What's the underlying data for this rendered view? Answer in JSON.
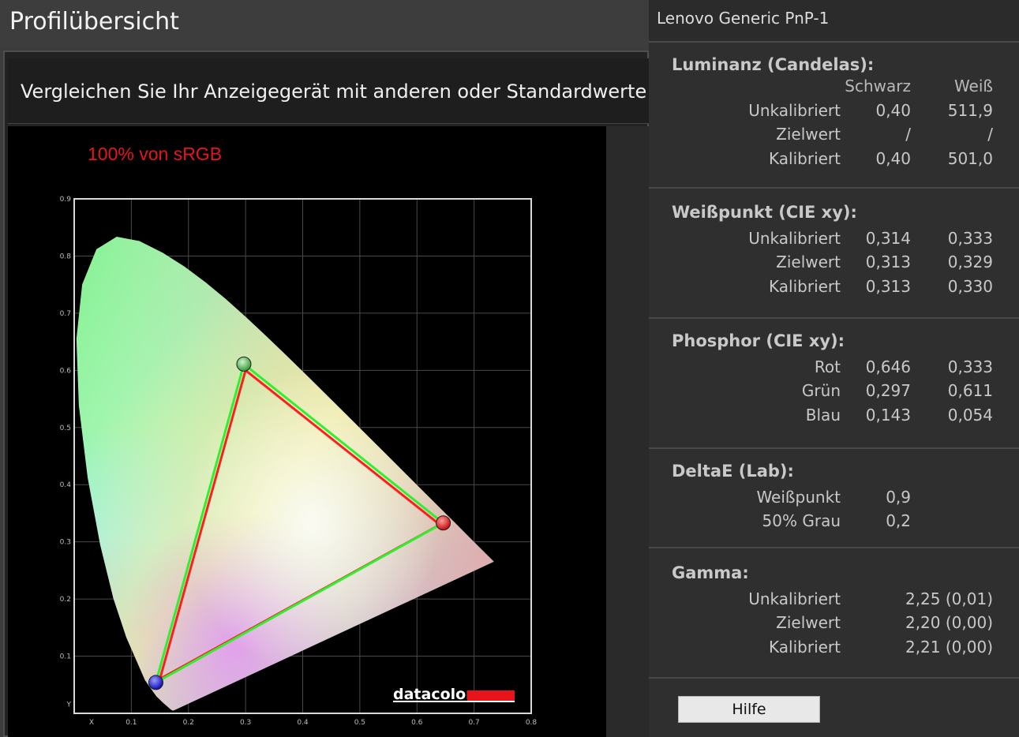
{
  "header": {
    "title": "Profilübersicht"
  },
  "description": "Vergleichen Sie Ihr Anzeigegerät mit anderen oder Standardwerte",
  "chart": {
    "coverage_label": "100% von sRGB",
    "logo_text": "datacolor",
    "colors": {
      "coverage": "#e8141c",
      "logo_bar": "#e8141c",
      "triangle_red": "#ff1e1e",
      "triangle_green": "#2ef02e"
    }
  },
  "chart_data": {
    "type": "scatter",
    "title": "",
    "xlabel": "X",
    "ylabel": "Y",
    "xlim": [
      0,
      0.8
    ],
    "ylim": [
      0,
      0.9
    ],
    "x_ticks": [
      "0.1",
      "0.2",
      "0.3",
      "0.4",
      "0.5",
      "0.6",
      "0.7",
      "0.8"
    ],
    "y_ticks": [
      "0.1",
      "0.2",
      "0.3",
      "0.4",
      "0.5",
      "0.6",
      "0.7",
      "0.8",
      "0.9"
    ],
    "grid": true,
    "series": [
      {
        "name": "",
        "color": "#ff1e1e",
        "points": [
          [
            0.64,
            0.33
          ],
          [
            0.3,
            0.6
          ],
          [
            0.15,
            0.06
          ]
        ]
      },
      {
        "name": "",
        "color": "#2ef02e",
        "points": [
          [
            0.646,
            0.333
          ],
          [
            0.297,
            0.611
          ],
          [
            0.143,
            0.054
          ]
        ]
      }
    ],
    "markers": [
      {
        "name": "red-primary",
        "x": 0.646,
        "y": 0.333,
        "color": "#ff2a2a"
      },
      {
        "name": "green-primary",
        "x": 0.297,
        "y": 0.611,
        "color": "#5fd35f"
      },
      {
        "name": "blue-primary",
        "x": 0.143,
        "y": 0.054,
        "color": "#2a2aff"
      }
    ]
  },
  "panel": {
    "title": "Lenovo Generic PnP-1",
    "luminance": {
      "title": "Luminanz (Candelas):",
      "col1": "Schwarz",
      "col2": "Weiß",
      "rows": [
        {
          "label": "Unkalibriert",
          "v1": "0,40",
          "v2": "511,9"
        },
        {
          "label": "Zielwert",
          "v1": "/",
          "v2": "/"
        },
        {
          "label": "Kalibriert",
          "v1": "0,40",
          "v2": "501,0"
        }
      ]
    },
    "whitepoint": {
      "title": "Weißpunkt (CIE xy):",
      "rows": [
        {
          "label": "Unkalibriert",
          "v1": "0,314",
          "v2": "0,333"
        },
        {
          "label": "Zielwert",
          "v1": "0,313",
          "v2": "0,329"
        },
        {
          "label": "Kalibriert",
          "v1": "0,313",
          "v2": "0,330"
        }
      ]
    },
    "phosphor": {
      "title": "Phosphor (CIE xy):",
      "rows": [
        {
          "label": "Rot",
          "v1": "0,646",
          "v2": "0,333"
        },
        {
          "label": "Grün",
          "v1": "0,297",
          "v2": "0,611"
        },
        {
          "label": "Blau",
          "v1": "0,143",
          "v2": "0,054"
        }
      ]
    },
    "deltae": {
      "title": "DeltaE (Lab):",
      "rows": [
        {
          "label": "Weißpunkt",
          "v1": "0,9"
        },
        {
          "label": "50% Grau",
          "v1": "0,2"
        }
      ]
    },
    "gamma": {
      "title": "Gamma:",
      "rows": [
        {
          "label": "Unkalibriert",
          "v2": "2,25 (0,01)"
        },
        {
          "label": "Zielwert",
          "v2": "2,20 (0,00)"
        },
        {
          "label": "Kalibriert",
          "v2": "2,21 (0,00)"
        }
      ]
    },
    "help_label": "Hilfe"
  }
}
